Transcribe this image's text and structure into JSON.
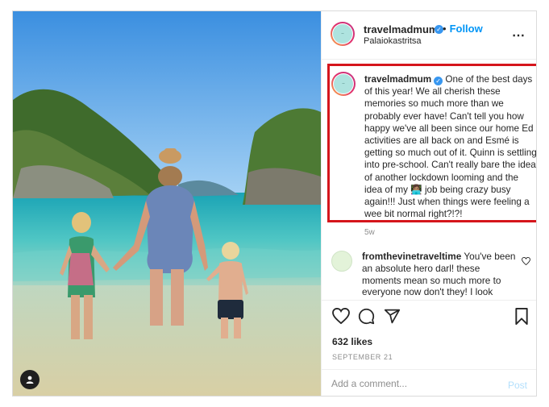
{
  "post": {
    "author": "travelmadmum",
    "follow_label": "Follow",
    "dot": "•",
    "location": "Palaiokastritsa",
    "more_label": "•••",
    "avatar_text": "Travel Mad Mum"
  },
  "caption": {
    "author": "travelmadmum",
    "text": "One of the best days of this year! We all cherish these memories so much more than we probably ever have! Can't tell you how happy we've all been since our home Ed activities are all back on and Esmé is getting so much out of it. Quinn is settling into pre-school. Can't really bare the idea of another lockdown looming and the idea of my 👩🏽‍💻 job being crazy busy again!!! Just when things were feeling a wee bit normal right?!?!",
    "age": "5w"
  },
  "comment": {
    "author": "fromthevinetraveltime",
    "text": "You've been an absolute hero darl! these moments mean so much more to everyone now don't they! I look"
  },
  "stats": {
    "likes": "632 likes",
    "date": "SEPTEMBER 21"
  },
  "add_comment": {
    "placeholder": "Add a comment...",
    "post_label": "Post"
  },
  "colors": {
    "accent": "#0095f6",
    "highlight_border": "#d5151c",
    "verified": "#3897f0"
  }
}
